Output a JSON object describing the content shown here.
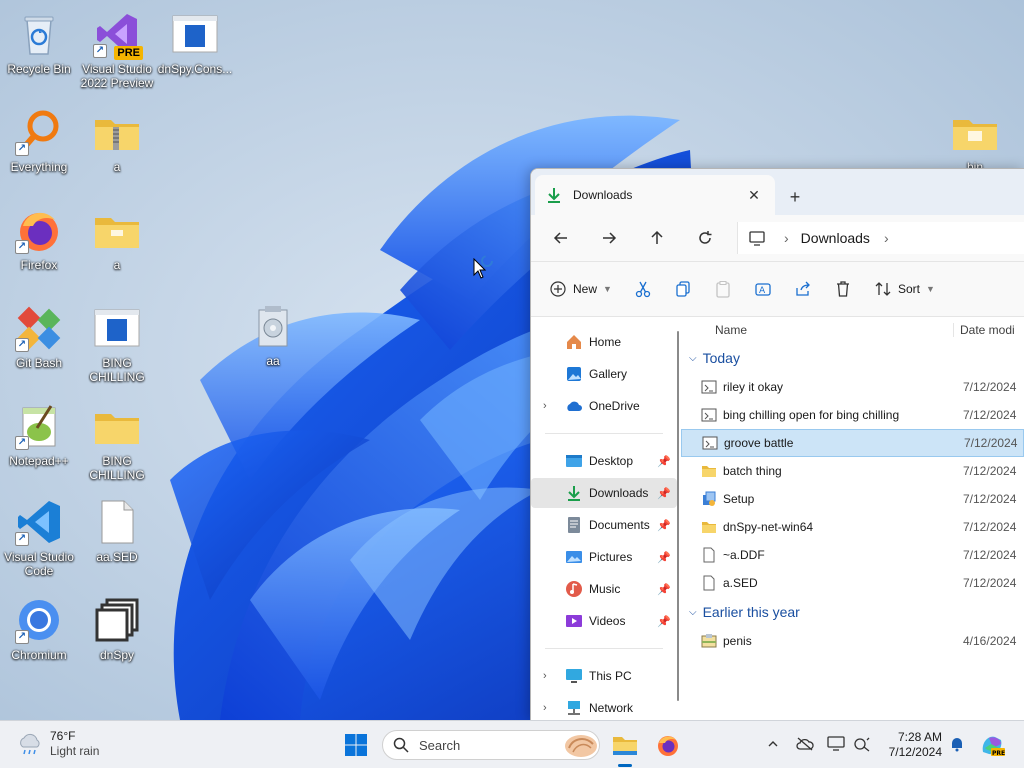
{
  "desktop": {
    "icons": [
      {
        "label": "Recycle Bin"
      },
      {
        "label": "Visual Studio 2022 Preview",
        "badge": "PRE"
      },
      {
        "label": "dnSpy.Cons..."
      },
      {
        "label": "Everything"
      },
      {
        "label": "a"
      },
      {
        "label": "Firefox"
      },
      {
        "label": "a"
      },
      {
        "label": "Git Bash"
      },
      {
        "label": "BING CHILLING"
      },
      {
        "label": "Notepad++"
      },
      {
        "label": "BING CHILLING"
      },
      {
        "label": "Visual Studio Code"
      },
      {
        "label": "aa.SED"
      },
      {
        "label": "Chromium"
      },
      {
        "label": "dnSpy"
      },
      {
        "label": "aa"
      },
      {
        "label": "bin"
      }
    ]
  },
  "explorer": {
    "tab": {
      "title": "Downloads",
      "close": "✕",
      "new_tab": "+"
    },
    "address": {
      "crumb": "Downloads",
      "sep": "›"
    },
    "commands": {
      "new_label": "New",
      "sort_label": "Sort"
    },
    "nav": {
      "home": "Home",
      "gallery": "Gallery",
      "onedrive": "OneDrive",
      "desktop": "Desktop",
      "downloads": "Downloads",
      "documents": "Documents",
      "pictures": "Pictures",
      "music": "Music",
      "videos": "Videos",
      "thispc": "This PC",
      "network": "Network"
    },
    "columns": {
      "name": "Name",
      "date": "Date modi"
    },
    "groups": [
      {
        "title": "Today",
        "files": [
          {
            "name": "riley it okay",
            "date": "7/12/2024",
            "type": "script"
          },
          {
            "name": "bing chilling open for bing chilling",
            "date": "7/12/2024",
            "type": "script"
          },
          {
            "name": "groove battle",
            "date": "7/12/2024",
            "type": "script",
            "selected": true
          },
          {
            "name": "batch thing",
            "date": "7/12/2024",
            "type": "folder"
          },
          {
            "name": "Setup",
            "date": "7/12/2024",
            "type": "setup"
          },
          {
            "name": "dnSpy-net-win64",
            "date": "7/12/2024",
            "type": "folder"
          },
          {
            "name": "~a.DDF",
            "date": "7/12/2024",
            "type": "file"
          },
          {
            "name": "a.SED",
            "date": "7/12/2024",
            "type": "file"
          }
        ]
      },
      {
        "title": "Earlier this year",
        "files": [
          {
            "name": "penis",
            "date": "4/16/2024",
            "type": "installer"
          }
        ]
      }
    ]
  },
  "taskbar": {
    "weather": {
      "temp": "76°F",
      "condition": "Light rain"
    },
    "search_placeholder": "Search",
    "clock": {
      "time": "7:28 AM",
      "date": "7/12/2024"
    }
  },
  "colors": {
    "accent": "#0067c0",
    "folder": "#f4c84a",
    "selection": "#cce4f7"
  }
}
